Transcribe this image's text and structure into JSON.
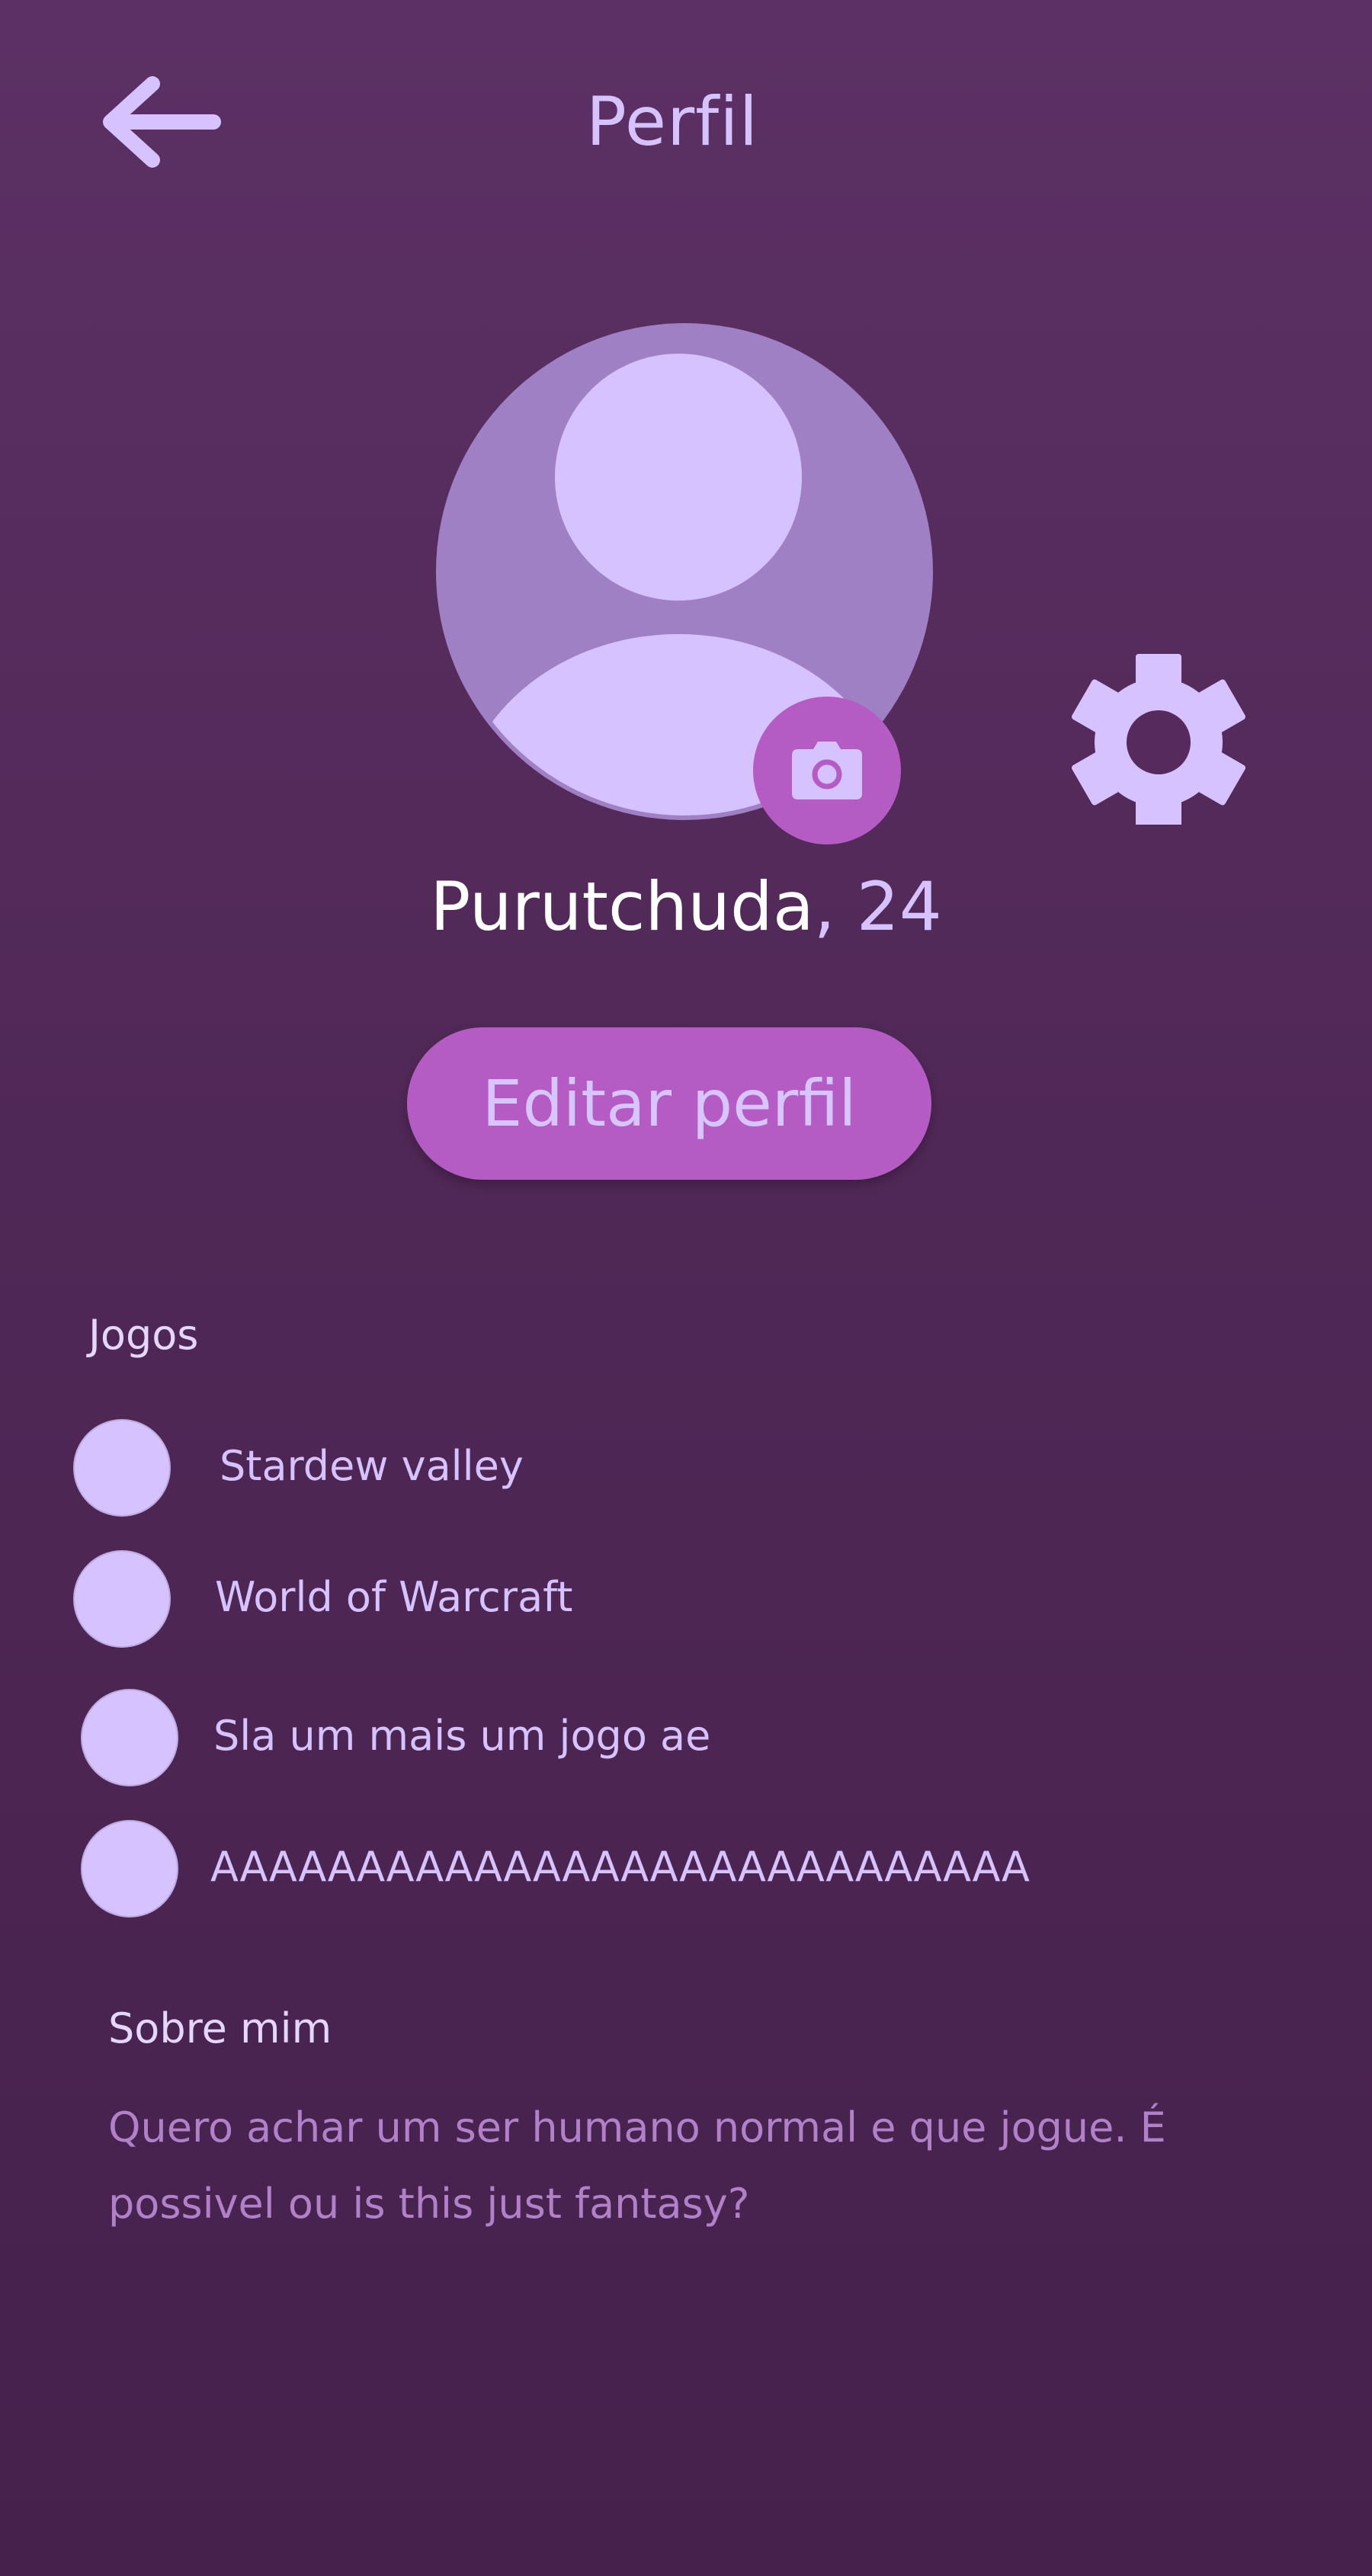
{
  "header": {
    "title": "Perfil"
  },
  "profile": {
    "name": "Purutchuda",
    "age_suffix": ", 24"
  },
  "actions": {
    "edit_label": "Editar perfil"
  },
  "games": {
    "heading": "Jogos",
    "items": [
      {
        "label": "Stardew valley"
      },
      {
        "label": "World of Warcraft"
      },
      {
        "label": "Sla um mais um jogo ae"
      },
      {
        "label": "AAAAAAAAAAAAAAAAAAAAAAAAAAAA"
      }
    ]
  },
  "about": {
    "heading": "Sobre mim",
    "text": "Quero achar um ser humano normal e que jogue. É possivel ou is this just fantasy?"
  },
  "icons": {
    "back": "arrow-left-icon",
    "camera": "camera-icon",
    "settings": "gear-icon",
    "avatar": "user-placeholder-icon"
  },
  "colors": {
    "background_top": "#5c3064",
    "background_bottom": "#46214c",
    "accent": "#b55cc4",
    "light_lavender": "#d6c2ff",
    "avatar_ring": "#a080c4",
    "muted_text": "#b080c8"
  }
}
